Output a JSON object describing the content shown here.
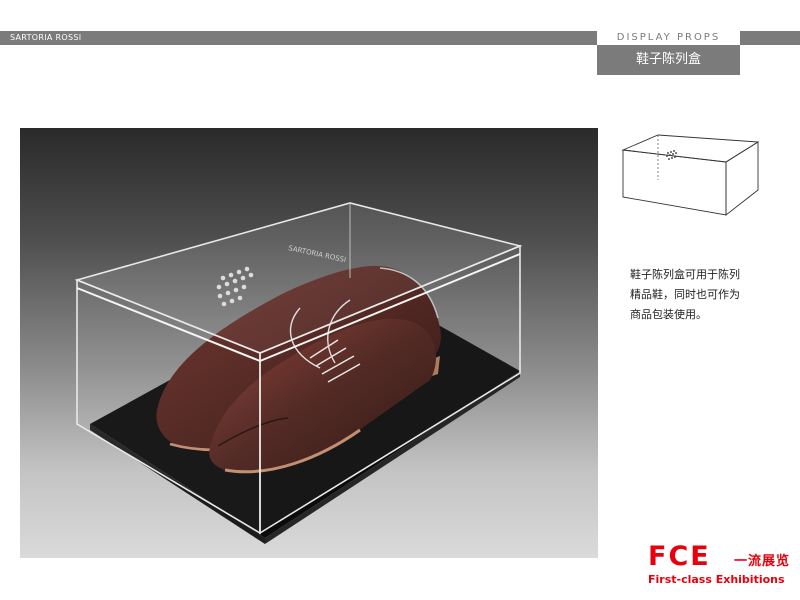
{
  "header": {
    "brand": "SARTORIA ROSSI",
    "section": "DISPLAY   PROPS",
    "subtitle": "鞋子陈列盒"
  },
  "hero": {
    "box_print": "SARTORIA ROSSI"
  },
  "description": {
    "lines": [
      "鞋子陈列盒可用于陈列",
      "精品鞋，同时也可作为",
      "商品包装使用。"
    ]
  },
  "logo": {
    "mark": "FCE",
    "chinese": "一流展览",
    "tagline": "First-class Exhibitions"
  },
  "colors": {
    "bar_gray": "#7b7b7b",
    "logo_red": "#e8000d",
    "shoe_brown": "#4a1f1a",
    "box_base": "#0b0b0b"
  },
  "icons": {
    "shoe": "oxford-shoe",
    "vent": "vent-holes"
  }
}
